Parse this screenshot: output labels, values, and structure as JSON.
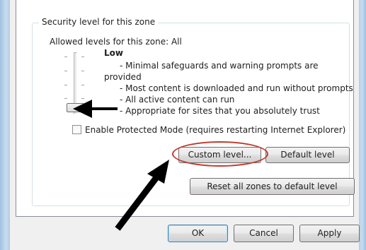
{
  "security_group": {
    "title": "Security level for this zone",
    "allowed_levels": "Allowed levels for this zone: All",
    "slider_level": "Low",
    "level_description": [
      "- Minimal safeguards and warning prompts are",
      "provided",
      "- Most content is downloaded and run without prompts",
      "- All active content can run",
      "- Appropriate for sites that you absolutely trust"
    ]
  },
  "protected_mode": {
    "label": "Enable Protected Mode (requires restarting Internet Explorer)",
    "checked": false
  },
  "buttons": {
    "custom_level": "Custom level...",
    "default_level": "Default level",
    "reset_all": "Reset all zones to default level"
  },
  "dialog_buttons": {
    "ok": "OK",
    "cancel": "Cancel",
    "apply": "Apply"
  },
  "annotations": {
    "arrow_color": "#000000",
    "ellipse_color": "#c0392b"
  }
}
